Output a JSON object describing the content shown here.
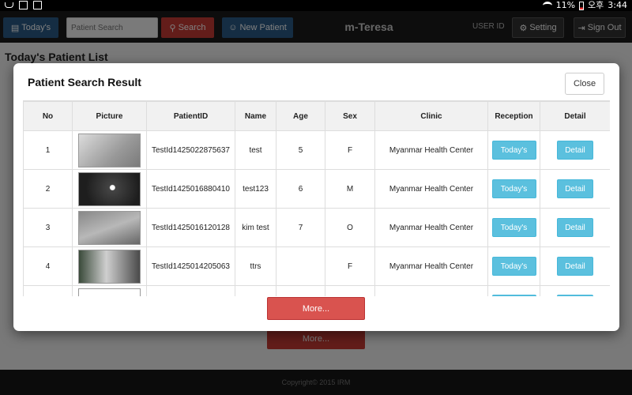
{
  "status_bar": {
    "battery": "11%",
    "ampm": "오후",
    "time": "3:44"
  },
  "header": {
    "todays_label": "Today's",
    "search_placeholder": "Patient Search",
    "search_label": "Search",
    "new_patient_label": "New Patient",
    "app_title": "m-Teresa",
    "user_id_label": "USER ID",
    "setting_label": "Setting",
    "sign_out_label": "Sign Out"
  },
  "page": {
    "title": "Today's Patient List",
    "more_label": "More...",
    "copyright": "Copyright© 2015 IRM"
  },
  "modal": {
    "title": "Patient Search Result",
    "close_label": "Close",
    "columns": [
      "No",
      "Picture",
      "PatientID",
      "Name",
      "Age",
      "Sex",
      "Clinic",
      "Reception",
      "Detail"
    ],
    "rows": [
      {
        "no": "1",
        "patient_id": "TestId1425022875637",
        "name": "test",
        "age": "5",
        "sex": "F",
        "clinic": "Myanmar Health Center",
        "reception": "Today's",
        "detail": "Detail"
      },
      {
        "no": "2",
        "patient_id": "TestId1425016880410",
        "name": "test123",
        "age": "6",
        "sex": "M",
        "clinic": "Myanmar Health Center",
        "reception": "Today's",
        "detail": "Detail"
      },
      {
        "no": "3",
        "patient_id": "TestId1425016120128",
        "name": "kim test",
        "age": "7",
        "sex": "O",
        "clinic": "Myanmar Health Center",
        "reception": "Today's",
        "detail": "Detail"
      },
      {
        "no": "4",
        "patient_id": "TestId1425014205063",
        "name": "ttrs",
        "age": "",
        "sex": "F",
        "clinic": "Myanmar Health Center",
        "reception": "Today's",
        "detail": "Detail"
      },
      {
        "no": "",
        "patient_id": "",
        "name": "",
        "age": "",
        "sex": "",
        "clinic": "",
        "reception": "",
        "detail": ""
      }
    ],
    "more_label": "More..."
  }
}
